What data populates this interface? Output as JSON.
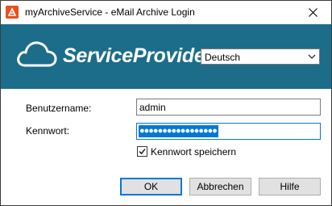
{
  "window": {
    "title": "myArchiveService - eMail Archive Login",
    "icon": "app-icon",
    "close_icon": "close-icon"
  },
  "banner": {
    "brand": "ServiceProvider",
    "logo_icon": "cloud-logo-icon",
    "background_color": "#1b6d8a",
    "language": {
      "selected": "Deutsch",
      "icon": "chevron-down-icon"
    }
  },
  "form": {
    "username_label": "Benutzername:",
    "username_value": "admin",
    "password_label": "Kennwort:",
    "password_masked": "●●●●●●●●●●●●●●●●●",
    "remember_label": "Kennwort speichern",
    "remember_checked": true
  },
  "buttons": {
    "ok": "OK",
    "cancel": "Abbrechen",
    "help": "Hilfe"
  },
  "colors": {
    "accent": "#0078d7"
  }
}
